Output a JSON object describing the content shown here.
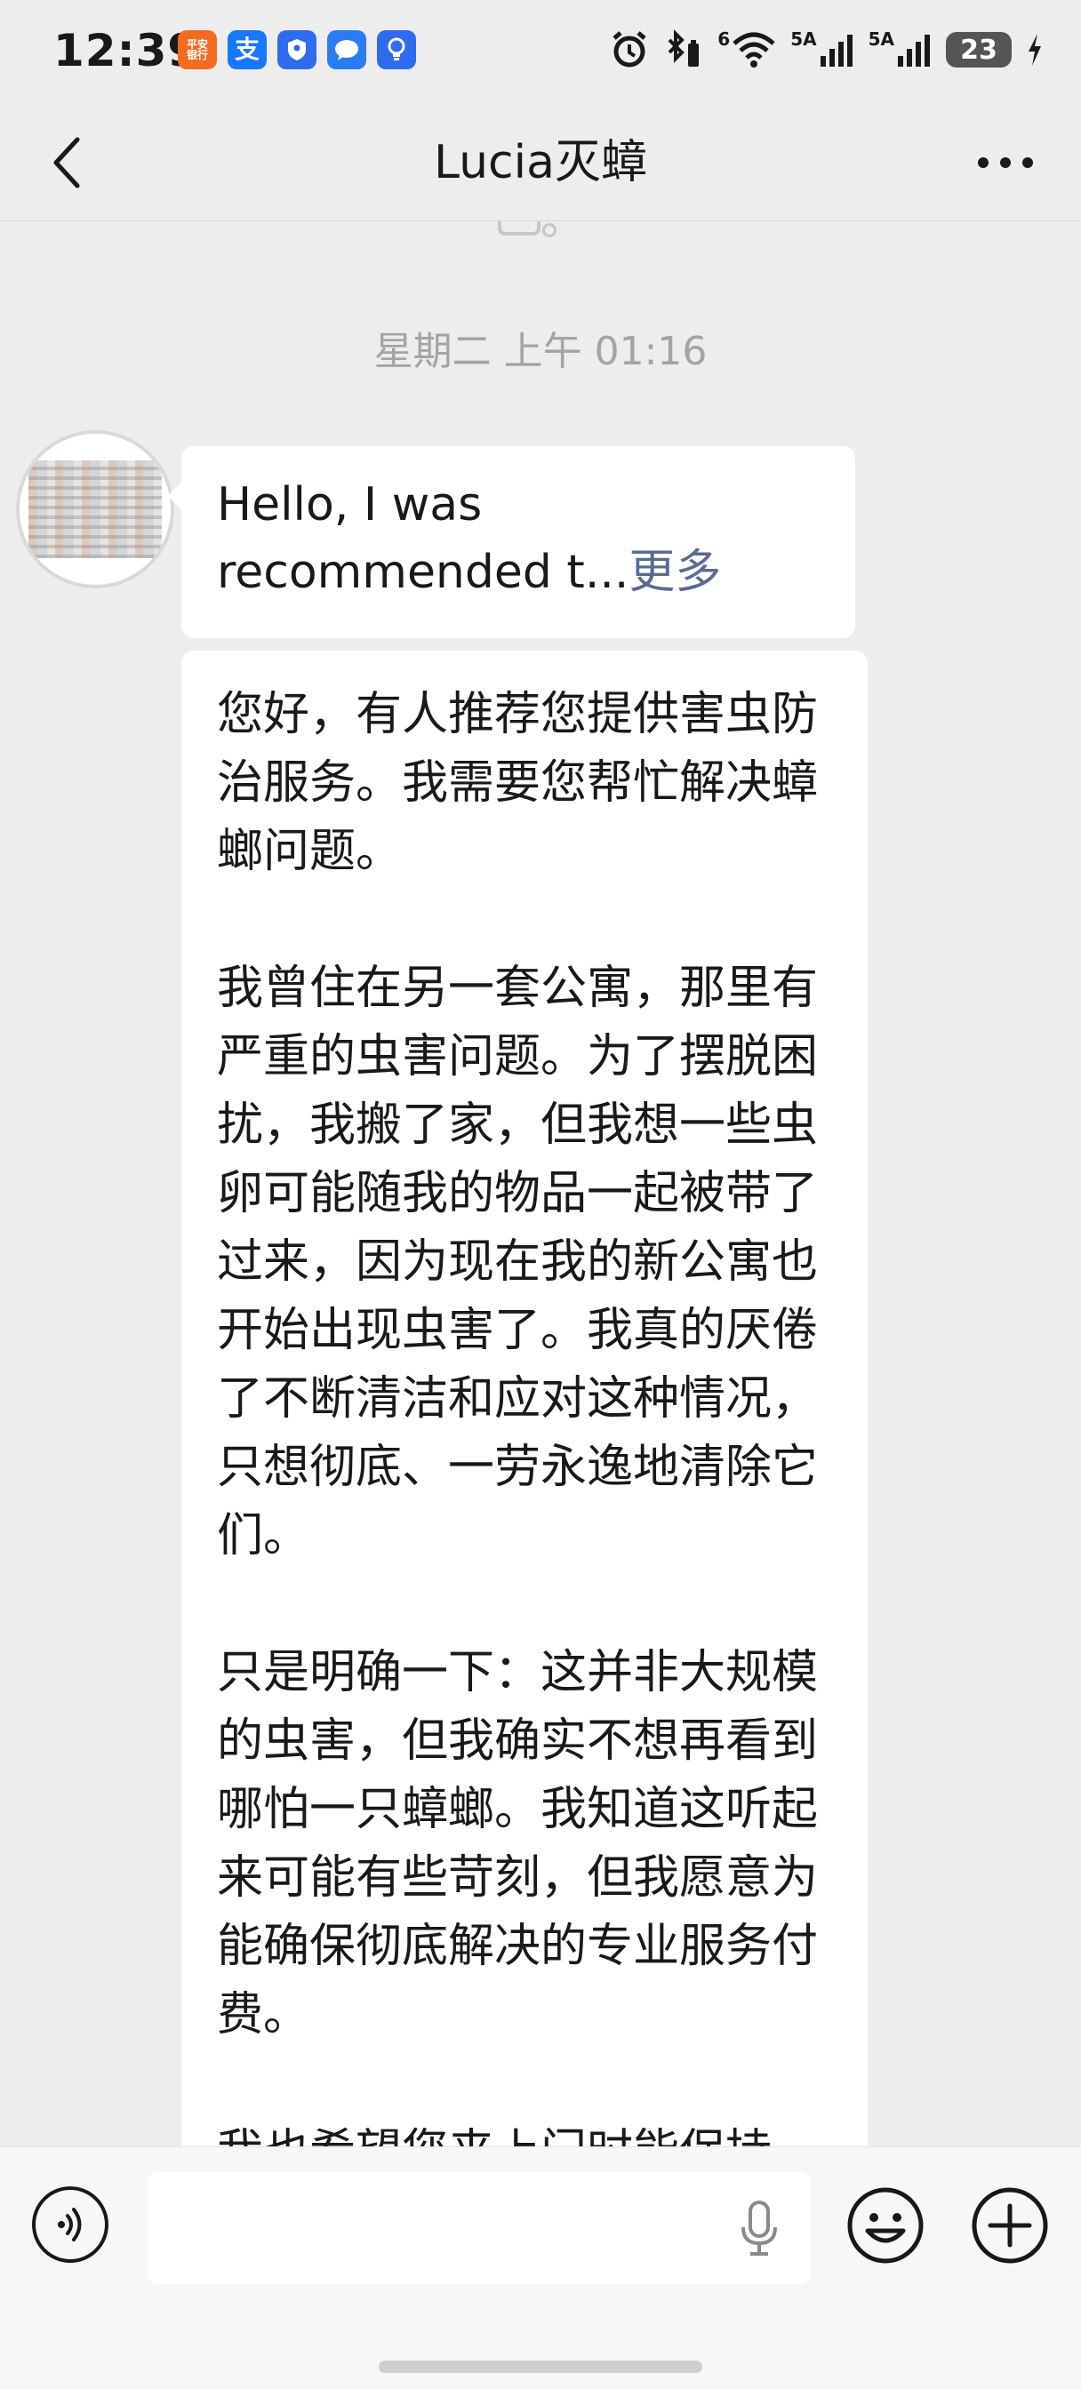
{
  "status_bar": {
    "time": "12:39",
    "app_icons": [
      {
        "name": "pingan-bank-icon",
        "label": "平安\n银行",
        "color": "#f26b21"
      },
      {
        "name": "alipay-icon",
        "label": "支",
        "color": "#1677ff"
      },
      {
        "name": "shield-app-icon",
        "label": "",
        "color": "#2f6bef"
      },
      {
        "name": "message-app-icon",
        "label": "",
        "color": "#2a7cf5"
      },
      {
        "name": "lightbulb-app-icon",
        "label": "",
        "color": "#2f6bef"
      }
    ],
    "network_1": "5A",
    "network_2": "5A",
    "wifi_tag": "6",
    "battery": "23"
  },
  "nav": {
    "title": "Lucia灭蟑"
  },
  "chat": {
    "timestamp": "星期二 上午 01:16",
    "messages": [
      {
        "type": "received-text-collapsed",
        "text": "Hello, I was recommended t...",
        "more_label": "更多"
      },
      {
        "type": "received-text",
        "paragraphs": [
          "您好，有人推荐您提供害虫防治服务。我需要您帮忙解决蟑螂问题。",
          "我曾住在另一套公寓，那里有严重的虫害问题。为了摆脱困扰，我搬了家，但我想一些虫卵可能随我的物品一起被带了过来，因为现在我的新公寓也开始出现虫害了。我真的厌倦了不断清洁和应对这种情况，只想彻底、一劳永逸地清除它们。",
          "只是明确一下：这并非大规模的虫害，但我确实不想再看到哪怕一只蟑螂。我知道这听起来可能有些苛刻，但我愿意为能确保彻底解决的专业服务付费。",
          "我也希望您来上门时能保持"
        ]
      }
    ]
  },
  "input_bar": {
    "text_value": "",
    "placeholder": ""
  },
  "colors": {
    "background": "#ededed",
    "bubble": "#ffffff",
    "link": "#576b95",
    "timestamp": "#a4a4a4"
  }
}
